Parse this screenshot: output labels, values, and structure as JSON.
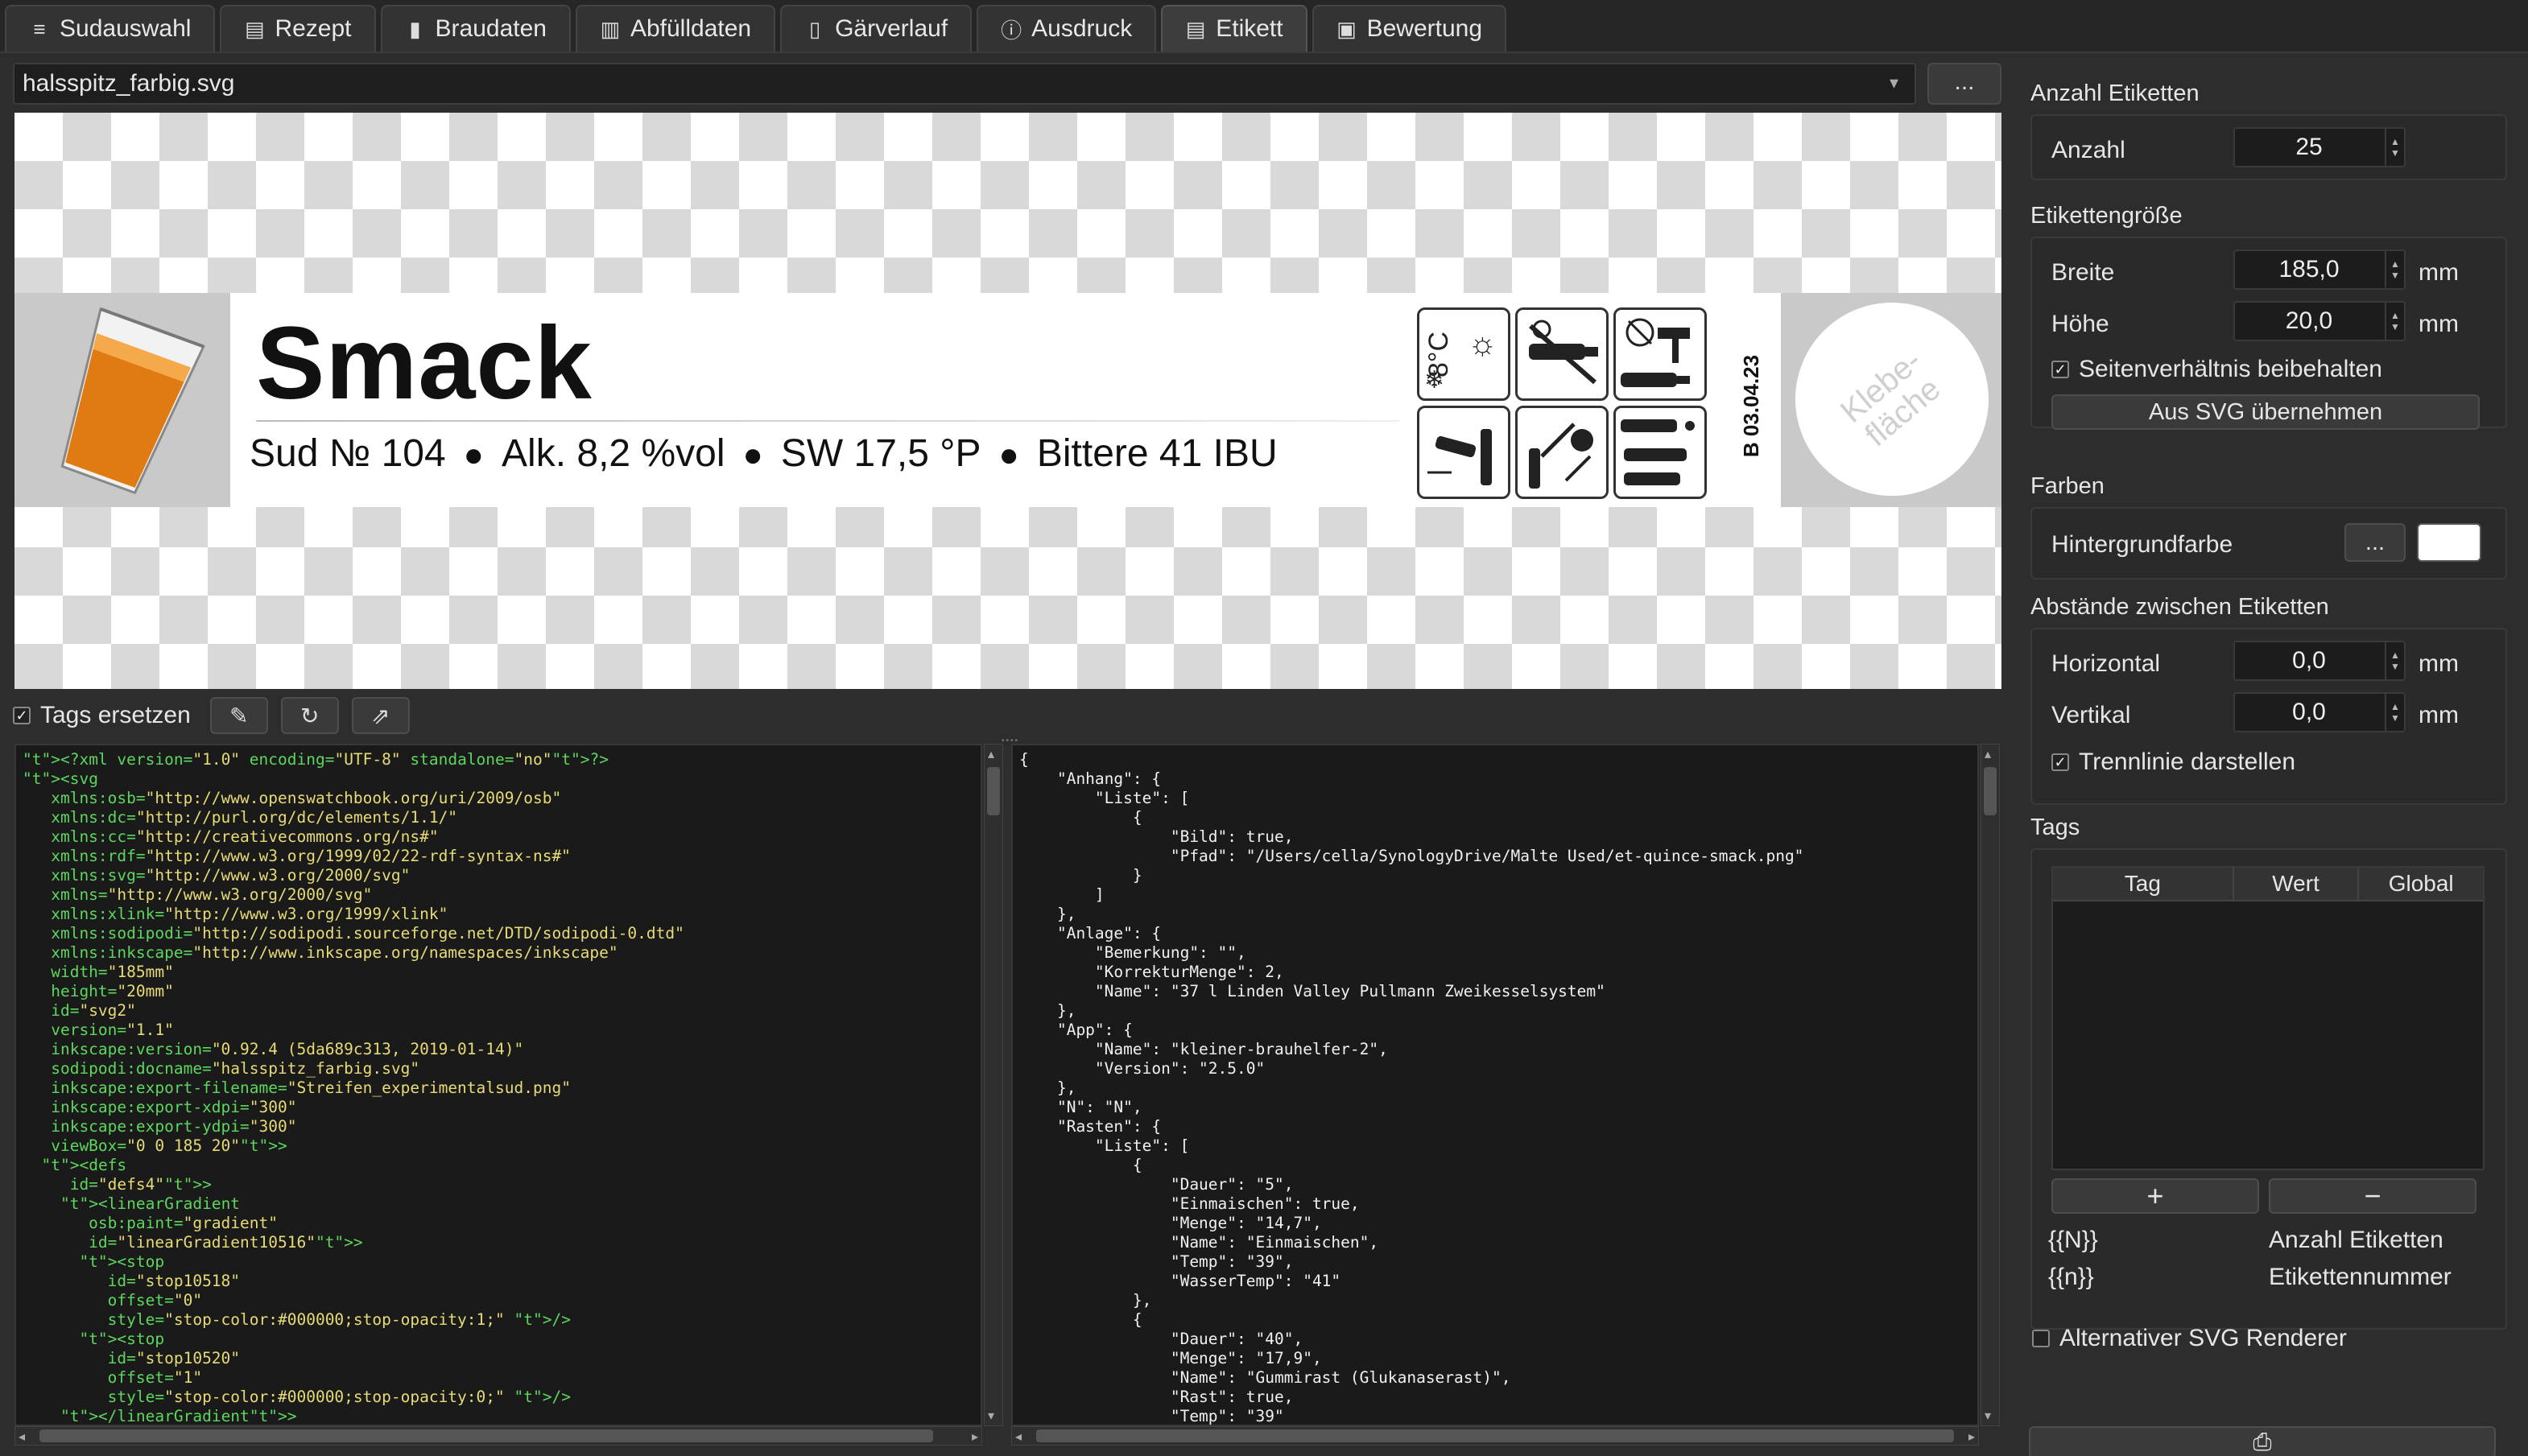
{
  "tabs": [
    {
      "label": "Sudauswahl",
      "icon": "menu-icon",
      "glyph": "≡"
    },
    {
      "label": "Rezept",
      "icon": "document-icon",
      "glyph": "▤"
    },
    {
      "label": "Braudaten",
      "icon": "cup-icon",
      "glyph": "▮"
    },
    {
      "label": "Abfülldaten",
      "icon": "bottles-icon",
      "glyph": "▥"
    },
    {
      "label": "Gärverlauf",
      "icon": "glass-icon",
      "glyph": "▯"
    },
    {
      "label": "Ausdruck",
      "icon": "info-icon",
      "glyph": "ⓘ"
    },
    {
      "label": "Etikett",
      "icon": "label-icon",
      "glyph": "▤"
    },
    {
      "label": "Bewertung",
      "icon": "rating-icon",
      "glyph": "▣"
    }
  ],
  "active_tab": "Etikett",
  "file": {
    "name": "halsspitz_farbig.svg",
    "button": "..."
  },
  "label": {
    "title": "Smack",
    "sud": "Sud № 104",
    "alk": "Alk. 8,2 %vol",
    "sw": "SW 17,5 °P",
    "bitter": "Bittere 41 IBU",
    "bdate": "B 03.04.23",
    "klebe": "Klebe-\nfläche",
    "temp": "8°C"
  },
  "toolbar": {
    "tags_ersetzen": "Tags ersetzen",
    "tags_checked": true
  },
  "xml_lines": [
    "<?xml version=\"1.0\" encoding=\"UTF-8\" standalone=\"no\"?>",
    "<svg",
    "   xmlns:osb=\"http://www.openswatchbook.org/uri/2009/osb\"",
    "   xmlns:dc=\"http://purl.org/dc/elements/1.1/\"",
    "   xmlns:cc=\"http://creativecommons.org/ns#\"",
    "   xmlns:rdf=\"http://www.w3.org/1999/02/22-rdf-syntax-ns#\"",
    "   xmlns:svg=\"http://www.w3.org/2000/svg\"",
    "   xmlns=\"http://www.w3.org/2000/svg\"",
    "   xmlns:xlink=\"http://www.w3.org/1999/xlink\"",
    "   xmlns:sodipodi=\"http://sodipodi.sourceforge.net/DTD/sodipodi-0.dtd\"",
    "   xmlns:inkscape=\"http://www.inkscape.org/namespaces/inkscape\"",
    "   width=\"185mm\"",
    "   height=\"20mm\"",
    "   id=\"svg2\"",
    "   version=\"1.1\"",
    "   inkscape:version=\"0.92.4 (5da689c313, 2019-01-14)\"",
    "   sodipodi:docname=\"halsspitz_farbig.svg\"",
    "   inkscape:export-filename=\"Streifen_experimentalsud.png\"",
    "   inkscape:export-xdpi=\"300\"",
    "   inkscape:export-ydpi=\"300\"",
    "   viewBox=\"0 0 185 20\">",
    "  <defs",
    "     id=\"defs4\">",
    "    <linearGradient",
    "       osb:paint=\"gradient\"",
    "       id=\"linearGradient10516\">",
    "      <stop",
    "         id=\"stop10518\"",
    "         offset=\"0\"",
    "         style=\"stop-color:#000000;stop-opacity:1;\" />",
    "      <stop",
    "         id=\"stop10520\"",
    "         offset=\"1\"",
    "         style=\"stop-color:#000000;stop-opacity:0;\" />",
    "    </linearGradient>"
  ],
  "json_lines": [
    "{",
    "    \"Anhang\": {",
    "        \"Liste\": [",
    "            {",
    "                \"Bild\": true,",
    "                \"Pfad\": \"/Users/cella/SynologyDrive/Malte Used/et-quince-smack.png\"",
    "            }",
    "        ]",
    "    },",
    "    \"Anlage\": {",
    "        \"Bemerkung\": \"\",",
    "        \"KorrekturMenge\": 2,",
    "        \"Name\": \"37 l Linden Valley Pullmann Zweikesselsystem\"",
    "    },",
    "    \"App\": {",
    "        \"Name\": \"kleiner-brauhelfer-2\",",
    "        \"Version\": \"2.5.0\"",
    "    },",
    "    \"N\": \"N\",",
    "    \"Rasten\": {",
    "        \"Liste\": [",
    "            {",
    "                \"Dauer\": \"5\",",
    "                \"Einmaischen\": true,",
    "                \"Menge\": \"14,7\",",
    "                \"Name\": \"Einmaischen\",",
    "                \"Temp\": \"39\",",
    "                \"WasserTemp\": \"41\"",
    "            },",
    "            {",
    "                \"Dauer\": \"40\",",
    "                \"Menge\": \"17,9\",",
    "                \"Name\": \"Gummirast (Glukanaserast)\",",
    "                \"Rast\": true,",
    "                \"Temp\": \"39\""
  ],
  "right": {
    "anzahl_section": "Anzahl Etiketten",
    "anzahl_label": "Anzahl",
    "anzahl_value": "25",
    "groesse_section": "Etikettengröße",
    "breite_label": "Breite",
    "breite_value": "185,0",
    "hoehe_label": "Höhe",
    "hoehe_value": "20,0",
    "unit": "mm",
    "seiten_label": "Seitenverhältnis beibehalten",
    "svg_button": "Aus SVG übernehmen",
    "farben_section": "Farben",
    "hintergrund_label": "Hintergrundfarbe",
    "dots_button": "...",
    "bg_color": "#ffffff",
    "abstaende_section": "Abstände zwischen Etiketten",
    "horizontal_label": "Horizontal",
    "horizontal_value": "0,0",
    "vertikal_label": "Vertikal",
    "vertikal_value": "0,0",
    "trennlinie_label": "Trennlinie darstellen",
    "tags_section": "Tags",
    "col_tag": "Tag",
    "col_wert": "Wert",
    "col_global": "Global",
    "add_button": "+",
    "remove_button": "−",
    "tag_N": "{{N}}",
    "tag_N_desc": "Anzahl Etiketten",
    "tag_n": "{{n}}",
    "tag_n_desc": "Etikettennummer",
    "alt_renderer": "Alternativer SVG Renderer"
  },
  "colors": {
    "beer": "#e07a12",
    "accent_bg": "#2d2d2d"
  }
}
